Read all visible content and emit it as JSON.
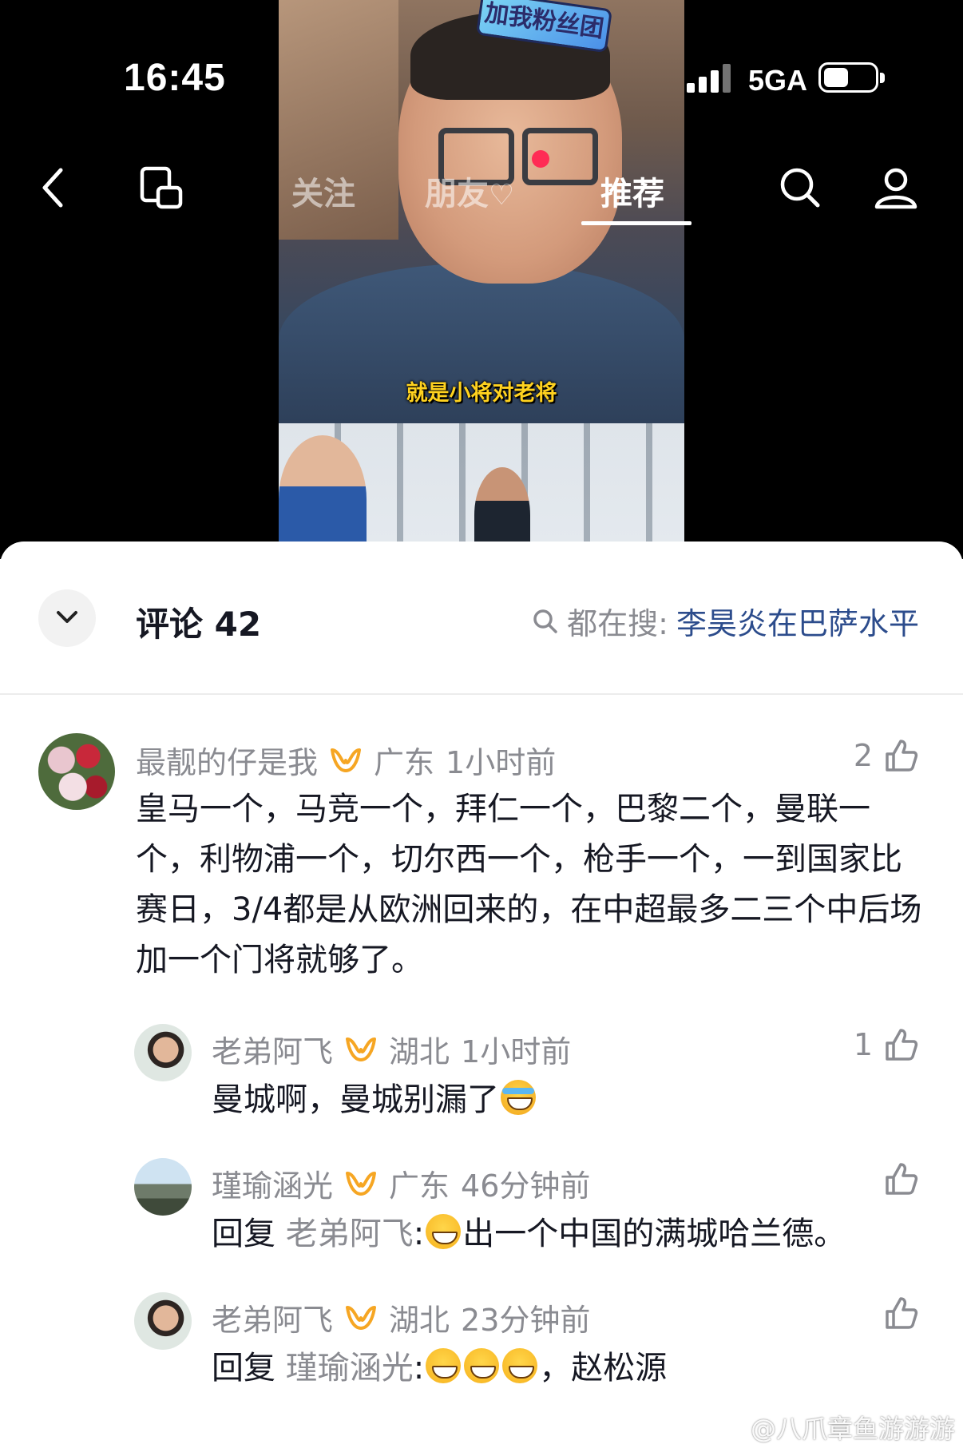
{
  "status_bar": {
    "time": "16:45",
    "network": "5GA"
  },
  "nav": {
    "tabs": [
      {
        "label": "关注",
        "active": false
      },
      {
        "label": "朋友",
        "active": false
      },
      {
        "label": "推荐",
        "active": true
      }
    ]
  },
  "video": {
    "badge_text": "加我粉丝团",
    "subtitle": "就是小将对老将"
  },
  "comments_header": {
    "title": "评论 42",
    "search_prefix": "都在搜:",
    "search_term": "李昊炎在巴萨水平"
  },
  "comments": [
    {
      "username": "最靓的仔是我",
      "location": "广东",
      "time": "1小时前",
      "likes": "2",
      "text": "皇马一个，马竞一个，拜仁一个，巴黎二个，曼联一个，利物浦一个，切尔西一个，枪手一个，一到国家比赛日，3/4都是从欧洲回来的，在中超最多二三个中后场加一个门将就够了。"
    },
    {
      "username": "老弟阿飞",
      "location": "湖北",
      "time": "1小时前",
      "likes": "1",
      "text": "曼城啊，曼城别漏了"
    },
    {
      "username": "瑾瑜涵光",
      "location": "广东",
      "time": "46分钟前",
      "likes": "",
      "reply_prefix": "回复",
      "reply_to": "老弟阿飞",
      "text": "出一个中国的满城哈兰德。"
    },
    {
      "username": "老弟阿飞",
      "location": "湖北",
      "time": "23分钟前",
      "likes": "",
      "reply_prefix": "回复",
      "reply_to": "瑾瑜涵光",
      "text": "，赵松源"
    }
  ],
  "watermark": "@八爪章鱼游游游",
  "colors": {
    "accent_link": "#2c4c8c",
    "fan_badge": "#f6a623",
    "secondary_text": "#8a8b91"
  }
}
